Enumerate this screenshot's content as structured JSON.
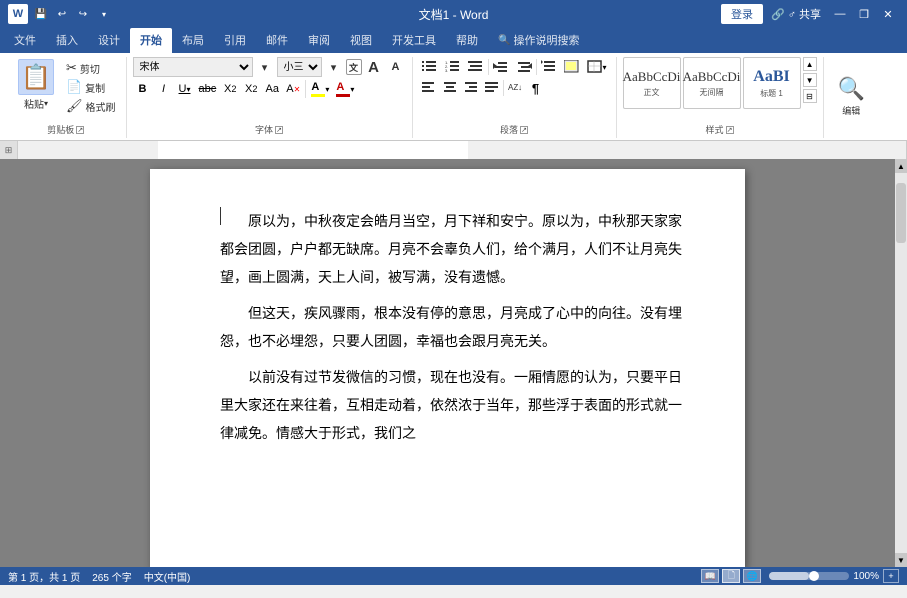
{
  "title_bar": {
    "app_title": "文档1 - Word",
    "login_label": "登录",
    "share_label": "♂ 共享",
    "minimize_label": "—",
    "restore_label": "❐",
    "close_label": "✕",
    "save_icon": "💾",
    "undo_icon": "↩",
    "redo_icon": "↪",
    "dropdown_icon": "▾"
  },
  "ribbon": {
    "tabs": [
      {
        "label": "文件",
        "active": false
      },
      {
        "label": "插入",
        "active": false
      },
      {
        "label": "设计",
        "active": false
      },
      {
        "label": "开始",
        "active": true
      },
      {
        "label": "布局",
        "active": false
      },
      {
        "label": "引用",
        "active": false
      },
      {
        "label": "邮件",
        "active": false
      },
      {
        "label": "审阅",
        "active": false
      },
      {
        "label": "视图",
        "active": false
      },
      {
        "label": "开发工具",
        "active": false
      },
      {
        "label": "帮助",
        "active": false
      },
      {
        "label": "操作说明搜索",
        "active": false
      }
    ],
    "groups": {
      "clipboard": {
        "label": "剪贴板",
        "paste_label": "粘贴",
        "cut_label": "剪切",
        "copy_label": "复制",
        "format_painter_label": "格式刷"
      },
      "font": {
        "label": "字体",
        "font_name": "宋体",
        "font_size": "小三",
        "bold": "B",
        "italic": "I",
        "underline": "U",
        "strikethrough": "abc",
        "subscript": "X₂",
        "superscript": "X²",
        "font_color_label": "A",
        "highlight_label": "A",
        "clear_format_label": "A",
        "grow_label": "A",
        "shrink_label": "A",
        "change_case_label": "Aa"
      },
      "paragraph": {
        "label": "段落",
        "bullets_label": "≡",
        "numbering_label": "≡",
        "multilevel_label": "≡",
        "decrease_indent_label": "⬅",
        "increase_indent_label": "➡",
        "align_left_label": "≡",
        "align_center_label": "≡",
        "align_right_label": "≡",
        "justify_label": "≡",
        "line_spacing_label": "↕",
        "shading_label": "▦",
        "border_label": "▣",
        "sort_label": "↕",
        "show_para_label": "¶"
      },
      "styles": {
        "label": "样式",
        "items": [
          {
            "preview_class": "normal",
            "preview_text": "AaBbCcDi",
            "label": "正文"
          },
          {
            "preview_class": "no-gap",
            "preview_text": "AaBbCcDi",
            "label": "无间隔"
          },
          {
            "preview_class": "heading1",
            "preview_text": "AaBI",
            "label": "标题 1"
          }
        ]
      },
      "editing": {
        "label": "编辑",
        "find_label": "编辑"
      }
    }
  },
  "document": {
    "paragraphs": [
      "原以为，中秋夜定会皓月当空，月下祥和安宁。原以为，中秋那天家家都会团圆，户户都无缺席。月亮不会辜负人们，给个满月，人们不让月亮失望，画上圆满，天上人间，被写满，没有遗憾。",
      "但这天，疾风骤雨，根本没有停的意思，月亮成了心中的向往。没有埋怨，也不必埋怨，只要人团圆，幸福也会跟月亮无关。",
      "以前没有过节发微信的习惯，现在也没有。一厢情愿的认为，只要平日里大家还在来往着，互相走动着，依然浓于当年，那些浮于表面的形式就一律减免。情感大于形式，我们之"
    ]
  },
  "status_bar": {
    "page_info": "第 1 页，共 1 页",
    "word_count": "265 个字",
    "lang": "中文(中国)",
    "zoom": "100%"
  }
}
